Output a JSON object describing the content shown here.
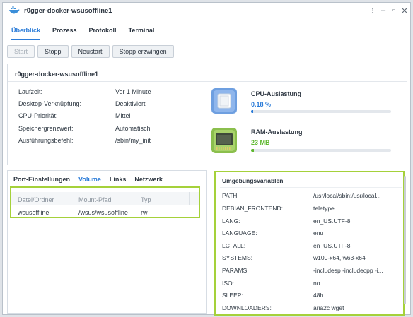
{
  "window": {
    "title": "r0gger-docker-wsusoffline1",
    "controls": [
      "more-icon",
      "minimize-icon",
      "maximize-icon",
      "close-icon"
    ]
  },
  "tabs": [
    {
      "label": "Überblick",
      "active": true
    },
    {
      "label": "Prozess",
      "active": false
    },
    {
      "label": "Protokoll",
      "active": false
    },
    {
      "label": "Terminal",
      "active": false
    }
  ],
  "toolbar": {
    "start": "Start",
    "stop": "Stopp",
    "restart": "Neustart",
    "force_stop": "Stopp erzwingen"
  },
  "overview": {
    "title": "r0gger-docker-wsusoffline1",
    "fields": [
      {
        "label": "Laufzeit:",
        "value": "Vor 1 Minute"
      },
      {
        "label": "Desktop-Verknüpfung:",
        "value": "Deaktiviert"
      },
      {
        "label": "CPU-Priorität:",
        "value": "Mittel"
      },
      {
        "label": "Speichergrenzwert:",
        "value": "Automatisch"
      },
      {
        "label": "Ausführungsbefehl:",
        "value": "/sbin/my_init"
      }
    ],
    "cpu": {
      "label": "CPU-Auslastung",
      "value": "0.18 %",
      "fraction": 0.0018,
      "color": "#2a7bd8"
    },
    "ram": {
      "label": "RAM-Auslastung",
      "value": "23 MB",
      "fraction": 0.02,
      "color": "#5fb830"
    }
  },
  "volume_panel": {
    "tabs": [
      {
        "label": "Port-Einstellungen",
        "active": false
      },
      {
        "label": "Volume",
        "active": true
      },
      {
        "label": "Links",
        "active": false
      },
      {
        "label": "Netzwerk",
        "active": false
      }
    ],
    "columns": [
      "Datei/Ordner",
      "Mount-Pfad",
      "Typ"
    ],
    "rows": [
      [
        "wsusoffline",
        "/wsus/wsusoffline",
        "rw"
      ]
    ]
  },
  "env_panel": {
    "title": "Umgebungsvariablen",
    "vars": [
      {
        "key": "PATH:",
        "value": "/usr/local/sbin:/usr/local..."
      },
      {
        "key": "DEBIAN_FRONTEND:",
        "value": "teletype"
      },
      {
        "key": "LANG:",
        "value": "en_US.UTF-8"
      },
      {
        "key": "LANGUAGE:",
        "value": "enu"
      },
      {
        "key": "LC_ALL:",
        "value": "en_US.UTF-8"
      },
      {
        "key": "SYSTEMS:",
        "value": "w100-x64, w63-x64"
      },
      {
        "key": "PARAMS:",
        "value": "-includesp -includecpp -i..."
      },
      {
        "key": "ISO:",
        "value": "no"
      },
      {
        "key": "SLEEP:",
        "value": "48h"
      },
      {
        "key": "DOWNLOADERS:",
        "value": "aria2c wget"
      }
    ]
  },
  "colors": {
    "accent": "#2a7bd8",
    "highlight": "#a5d13a",
    "ram": "#5fb830"
  }
}
